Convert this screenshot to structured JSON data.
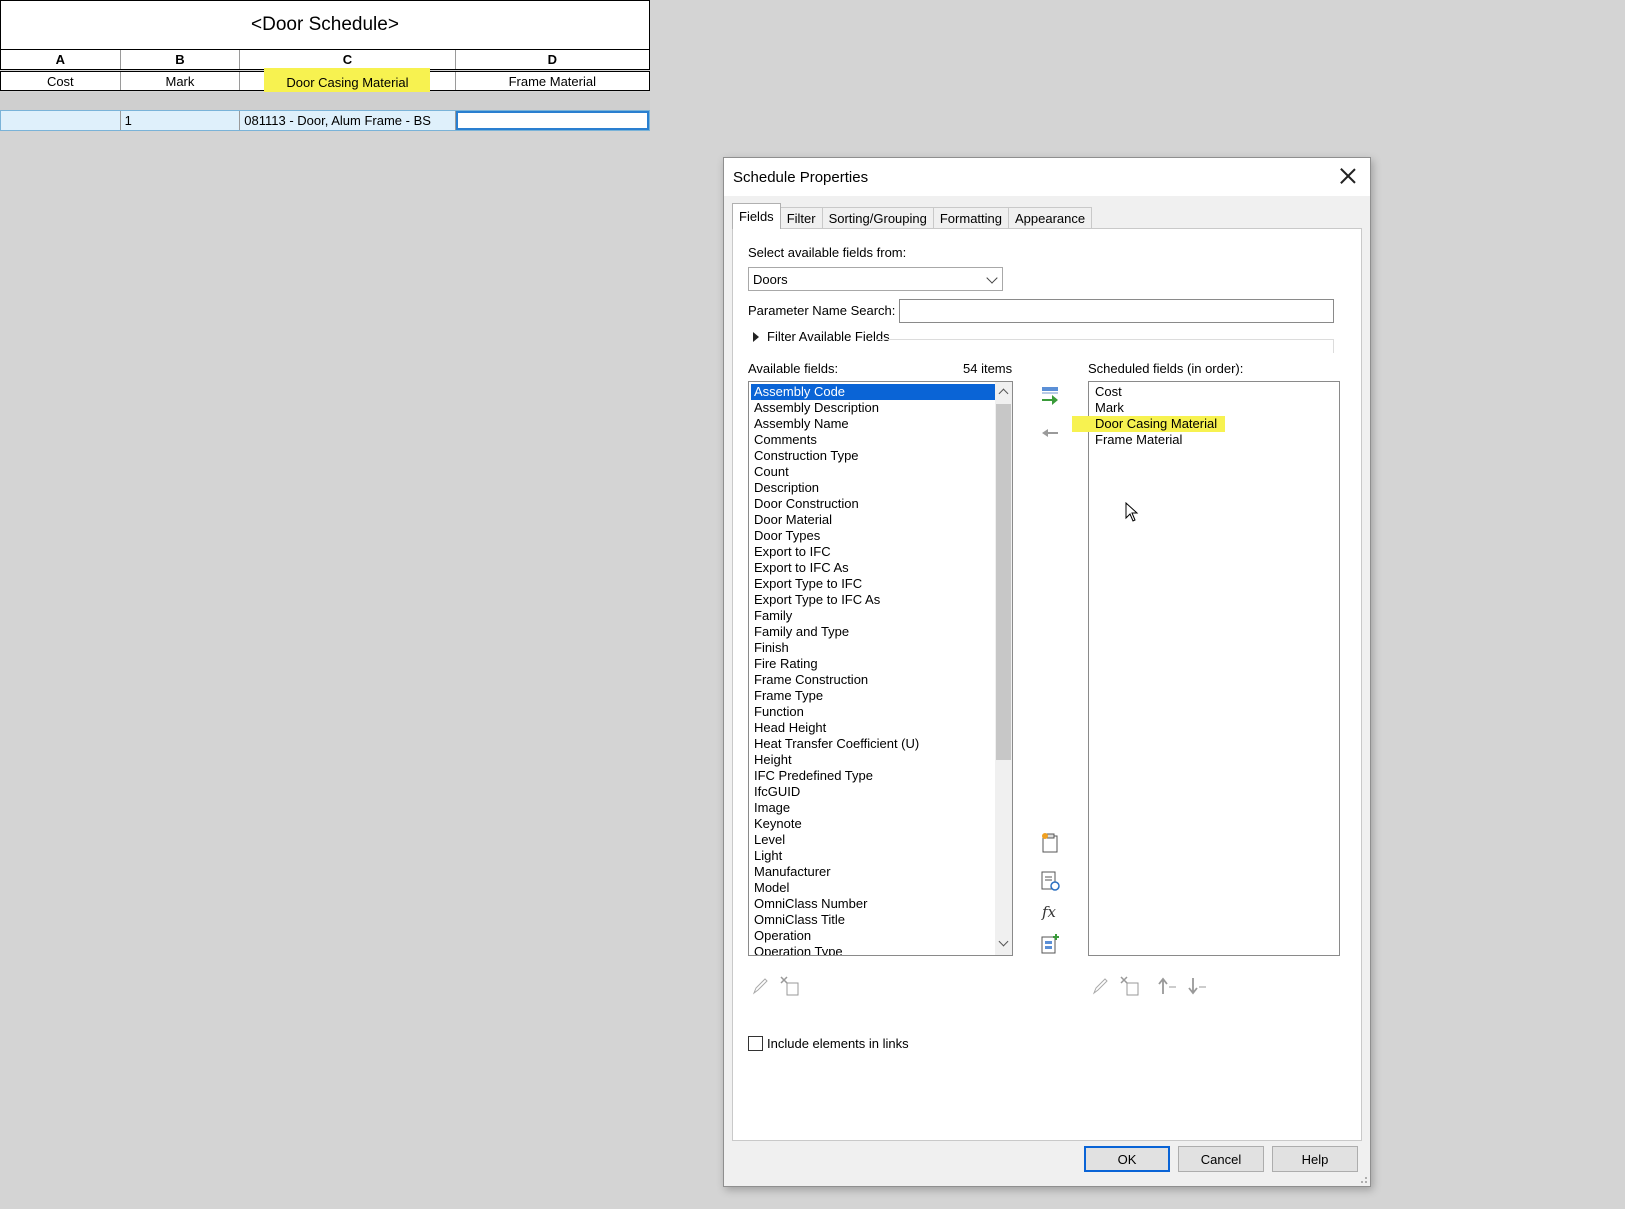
{
  "schedule": {
    "title": "<Door Schedule>",
    "column_letters": [
      "A",
      "B",
      "C",
      "D"
    ],
    "headers": [
      "Cost",
      "Mark",
      "Door Casing Material",
      "Frame Material"
    ],
    "row": [
      "",
      "1",
      "081113 - Door, Alum Frame - BS",
      ""
    ]
  },
  "dialog": {
    "title": "Schedule Properties",
    "tabs": [
      "Fields",
      "Filter",
      "Sorting/Grouping",
      "Formatting",
      "Appearance"
    ],
    "select_label": "Select available fields from:",
    "select_value": "Doors",
    "search_label": "Parameter Name Search:",
    "search_value": "",
    "filter_label": "Filter Available Fields",
    "available_label": "Available fields:",
    "available_count": "54 items",
    "available_fields": [
      "Assembly Code",
      "Assembly Description",
      "Assembly Name",
      "Comments",
      "Construction Type",
      "Count",
      "Description",
      "Door Construction",
      "Door Material",
      "Door Types",
      "Export to IFC",
      "Export to IFC As",
      "Export Type to IFC",
      "Export Type to IFC As",
      "Family",
      "Family and Type",
      "Finish",
      "Fire Rating",
      "Frame Construction",
      "Frame Type",
      "Function",
      "Head Height",
      "Heat Transfer Coefficient (U)",
      "Height",
      "IFC Predefined Type",
      "IfcGUID",
      "Image",
      "Keynote",
      "Level",
      "Light",
      "Manufacturer",
      "Model",
      "OmniClass Number",
      "OmniClass Title",
      "Operation",
      "Operation Type"
    ],
    "selected_available": "Assembly Code",
    "scheduled_label": "Scheduled fields (in order):",
    "scheduled_fields": [
      "Cost",
      "Mark",
      "Door Casing Material",
      "Frame Material"
    ],
    "include_links_label": "Include elements in links",
    "ok": "OK",
    "cancel": "Cancel",
    "help": "Help"
  },
  "colors": {
    "highlight": "#f7f250",
    "selection": "#0a64d6"
  }
}
